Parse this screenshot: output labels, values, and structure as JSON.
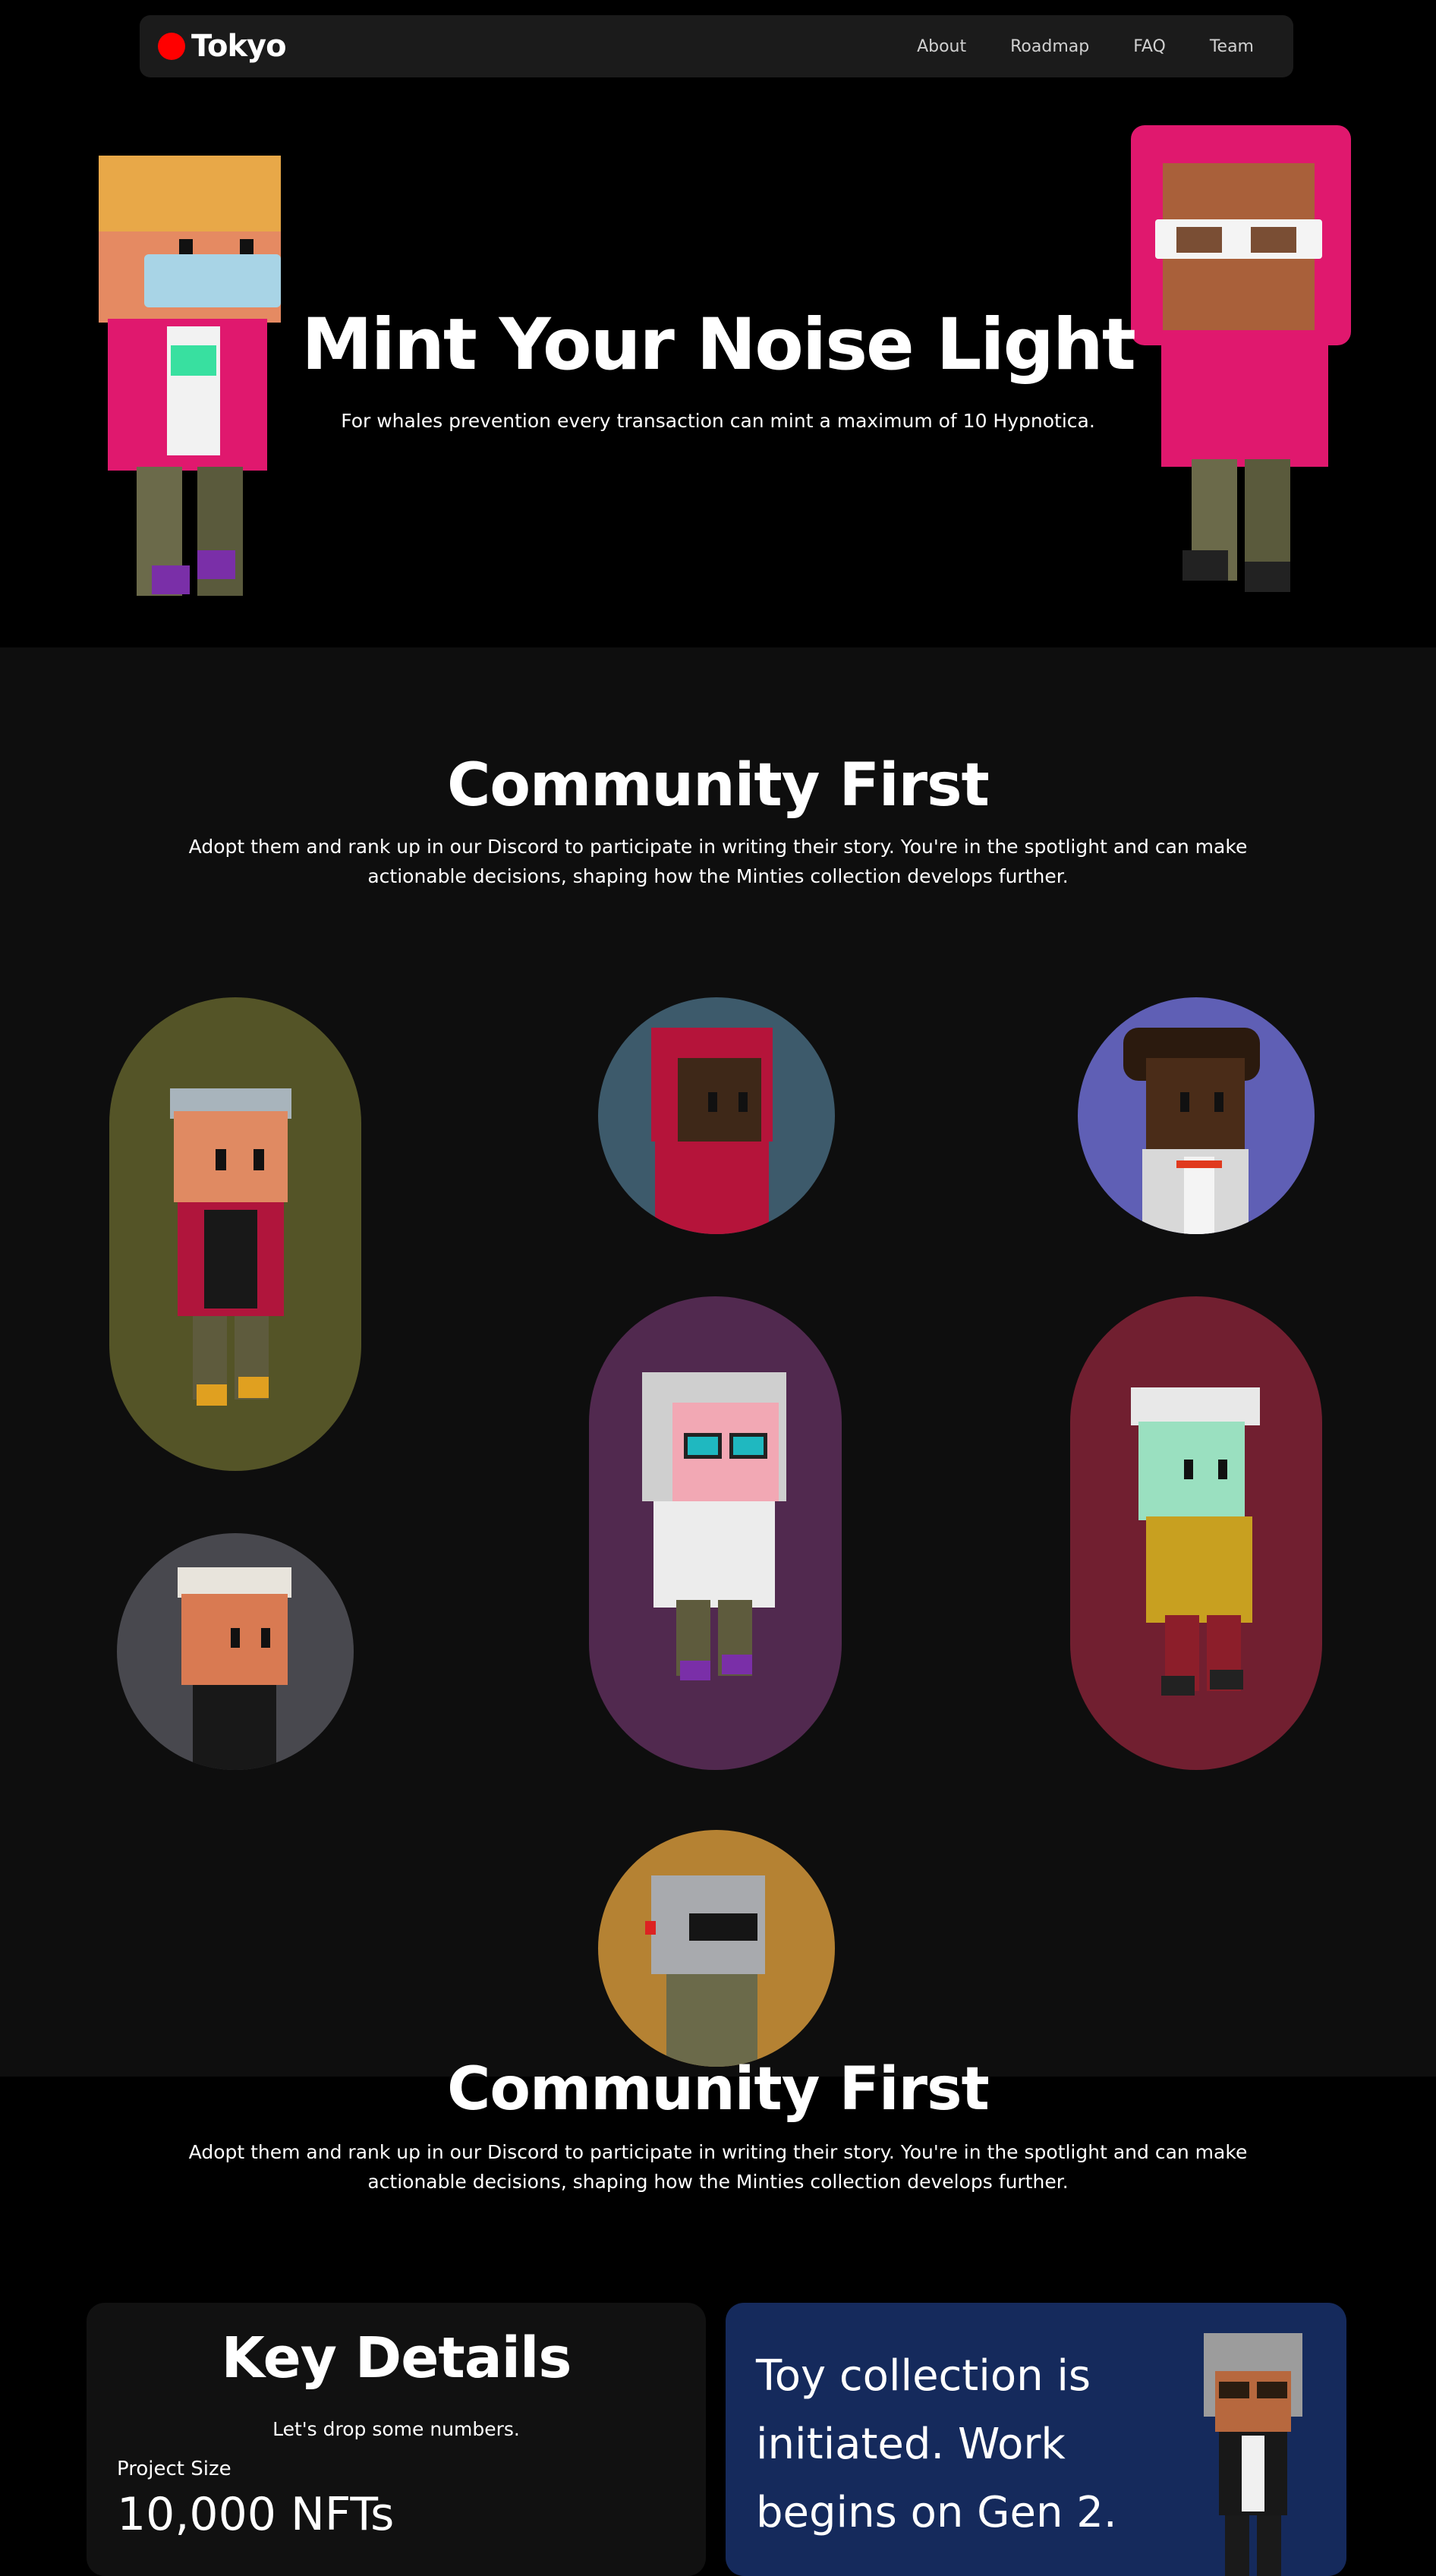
{
  "nav": {
    "brand": "Tokyo",
    "links": [
      "About",
      "Roadmap",
      "FAQ",
      "Team"
    ]
  },
  "hero": {
    "title": "Mint Your Noise Light",
    "subtitle": "For whales prevention every transaction can mint a maximum of 10 Hypnotica."
  },
  "community": {
    "title": "Community First",
    "description": "Adopt them and rank up in our Discord to participate in writing their story. You're in the spotlight and can make actionable decisions, shaping how the Minties collection develops further.",
    "gallery_colors": [
      "#545427",
      "#3d5a6b",
      "#5f5fb5",
      "#48484e",
      "#51294f",
      "#711f30",
      "#b58233"
    ]
  },
  "community_repeat": {
    "title": "Community First",
    "description": "Adopt them and rank up in our Discord to participate in writing their story. You're in the spotlight and can make actionable decisions, shaping how the Minties collection develops further."
  },
  "key_details": {
    "title": "Key Details",
    "subtitle": "Let's drop some numbers.",
    "project_size_label": "Project Size",
    "project_size_value": "10,000 NFTs"
  },
  "toy": {
    "text": "Toy collection is initiated. Work begins on Gen 2."
  }
}
